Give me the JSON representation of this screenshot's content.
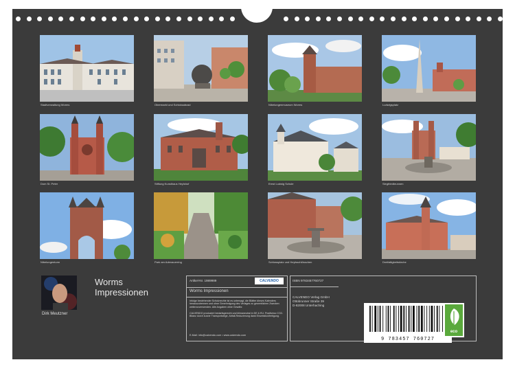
{
  "title_lines": [
    "Worms",
    "Impressionen"
  ],
  "author": "Dirk Meutzner",
  "photos": [
    {
      "caption": "Stadtverwaltung Worms"
    },
    {
      "caption": "Obermarkt und Schicksalsrad"
    },
    {
      "caption": "Nibelungenmuseum Worms"
    },
    {
      "caption": "Ludwigsplatz"
    },
    {
      "caption": "Dom St. Peter"
    },
    {
      "caption": "Stiftung Kunsthaus Heylshof"
    },
    {
      "caption": "Ernst Ludwig Schule"
    },
    {
      "caption": "Siegfriedbrunnen"
    },
    {
      "caption": "Nibelungenturm"
    },
    {
      "caption": "Park am Adenauerring"
    },
    {
      "caption": "Schlossplatz und Heylsschlösschen"
    },
    {
      "caption": "Dreifaltigkeitskirche"
    }
  ],
  "info": {
    "article_no": "Artikel-Nr. 1989989",
    "publisher_logo": "CALVENDO",
    "calendar_title": "Worms Impressionen",
    "copyright_text": "Infolge bestehender Schutzrechte ist es untersagt, die Blätter dieses Kalenders herauszutrennen und ohne Genehmigung des Verlages zu gewerblichen Zwecken weiterzuverwenden. Alle Angaben ohne Gewähr.",
    "production_text": "CALVENDO produziert bedarfsgerecht und klimaneutral in DE & EU. Positiveco CO2-Bilanz durch kurzer Transportwege, Abfall-Reduzierung dank Einzelstückfertigung.",
    "contact": "E-Mail: info@calvendo.com • www.calvendo.com",
    "isbn": "ISBN 9783457760727",
    "address_lines": [
      "CALVENDO Verlag GmbH",
      "Ottobrunner Straße 39",
      "D-82008 Unterhaching"
    ],
    "barcode_number": "9 783457 760727",
    "eco_label": "eco"
  }
}
